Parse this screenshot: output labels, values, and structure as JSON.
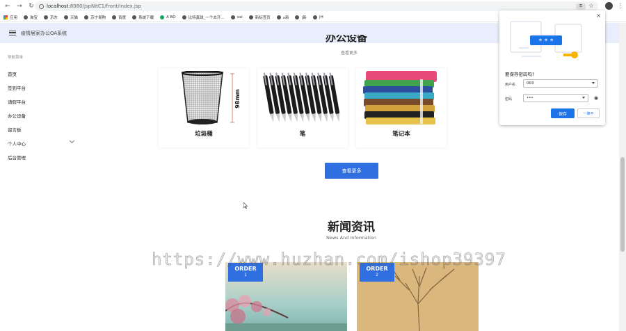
{
  "browser": {
    "url_host": "localhost",
    "url_path": ":8080/jspNitC1/front/index.jsp",
    "bookmarks": [
      "应用",
      "淘宝",
      "京东",
      "天猫",
      "苏宁易购",
      "百度",
      "系统下载",
      "A BO",
      "比特鑫球_一个去开...",
      "xxi",
      "新标签页",
      "x新",
      "|新",
      "|H"
    ]
  },
  "app": {
    "title": "疫情居家办公OA系统"
  },
  "sidebar": {
    "heading": "导航菜单",
    "items": [
      "首页",
      "签到平台",
      "请假平台",
      "办公设备",
      "留言板",
      "个人中心",
      "后台管理"
    ]
  },
  "equipment": {
    "title": "办公设备",
    "subtitle": "查看更多",
    "items": [
      {
        "caption": "垃圾桶",
        "dim_label": "98mm"
      },
      {
        "caption": "笔"
      },
      {
        "caption": "笔记本"
      }
    ],
    "more_button": "查看更多"
  },
  "news": {
    "title": "新闻资讯",
    "subtitle": "News And Information",
    "badges": [
      {
        "label": "ORDER",
        "num": "1"
      },
      {
        "label": "ORDER",
        "num": "2"
      }
    ]
  },
  "watermark": "https://www.huzhan.com/ishop39397",
  "password_popup": {
    "question": "要保存密码吗?",
    "username_label": "用户名",
    "username_value": "003",
    "password_label": "密码",
    "password_value": "•••",
    "save_label": "保存",
    "never_label": "一律不",
    "illustration_text": "* * *",
    "close_symbol": "×"
  },
  "colors": {
    "accent": "#2f6fe0",
    "header_bg": "#e8eefb",
    "chrome_blue": "#1a73e8"
  }
}
